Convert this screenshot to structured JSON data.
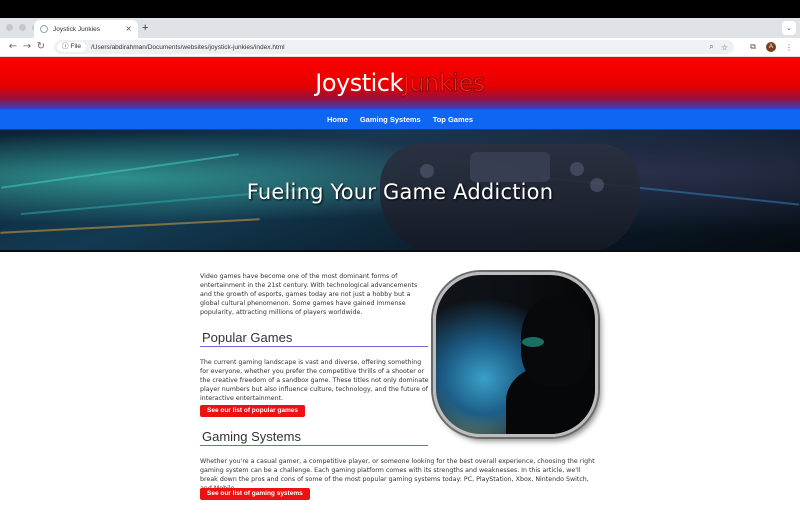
{
  "browser": {
    "tab_title": "Joystick Junkies",
    "tab_close": "×",
    "new_tab": "+",
    "tab_menu": "⌄",
    "back": "←",
    "forward": "→",
    "reload": "↻",
    "file_chip": "File",
    "url": "/Users/abdirahman/Documents/websites/joystick-junkies/index.html",
    "profile_initial": "A"
  },
  "site": {
    "logo_part1": "Joystick",
    "logo_part2": "Junkies",
    "nav": [
      "Home",
      "Gaming Systems",
      "Top Games"
    ],
    "hero_title": "Fueling Your Game Addiction"
  },
  "content": {
    "intro": "Video games have become one of the most dominant forms of entertainment in the 21st century. With technological advancements and the growth of esports, games today are not just a hobby but a global cultural phenomenon. Some games have gained immense popularity, attracting millions of players worldwide.",
    "popular_heading": "Popular Games",
    "popular_text": "The current gaming landscape is vast and diverse, offering something for everyone, whether you prefer the competitive thrills of a shooter or the creative freedom of a sandbox game. These titles not only dominate player numbers but also influence culture, technology, and the future of interactive entertainment.",
    "popular_button": "See our list of popular games",
    "systems_heading": "Gaming Systems",
    "systems_text": "Whether you're a casual gamer, a competitive player, or someone looking for the best overall experience, choosing the right gaming system can be a challenge. Each gaming platform comes with its strengths and weaknesses. In this article, we'll break down the pros and cons of some of the most popular gaming systems today: PC, PlayStation, Xbox, Nintendo Switch, and Mobile.",
    "systems_button": "See our list of gaming systems"
  },
  "colors": {
    "brand_red": "#ff0000",
    "nav_blue": "#0f66f2",
    "cta_red": "#ee1111"
  }
}
